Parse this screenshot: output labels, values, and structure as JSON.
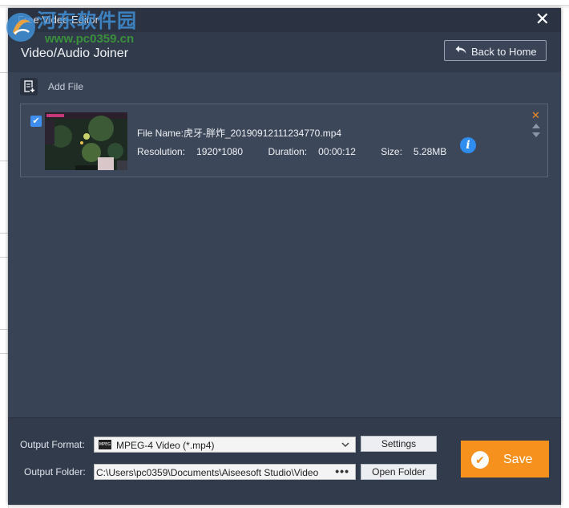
{
  "window": {
    "title": "Free Video Editor",
    "close_glyph": "✕"
  },
  "watermark": {
    "name": "河东软件园",
    "url": "www.pc0359.cn"
  },
  "header": {
    "title": "Video/Audio Joiner",
    "back_button": "Back to Home",
    "back_icon": "reply-arrow-icon"
  },
  "toolbar": {
    "add_file_label": "Add File",
    "add_file_icon": "add-file-icon"
  },
  "files": [
    {
      "checked": true,
      "name_label": "File Name:",
      "name": "虎牙-胖炸_20190912111234770.mp4",
      "resolution_label": "Resolution:",
      "resolution": "1920*1080",
      "duration_label": "Duration:",
      "duration": "00:00:12",
      "size_label": "Size:",
      "size": "5.28MB"
    }
  ],
  "output": {
    "format_label": "Output Format:",
    "format_icon_text": "MPEG",
    "format_value": "MPEG-4 Video (*.mp4)",
    "settings_button": "Settings",
    "folder_label": "Output Folder:",
    "folder_value": "C:\\Users\\pc0359\\Documents\\Aiseesoft Studio\\Video",
    "browse_glyph": "•••",
    "open_folder_button": "Open Folder"
  },
  "save_button": "Save",
  "colors": {
    "dialog_bg": "#394356",
    "accent_orange": "#f7911e",
    "checkbox_blue": "#3f8ff2",
    "info_blue": "#2f8df0"
  }
}
